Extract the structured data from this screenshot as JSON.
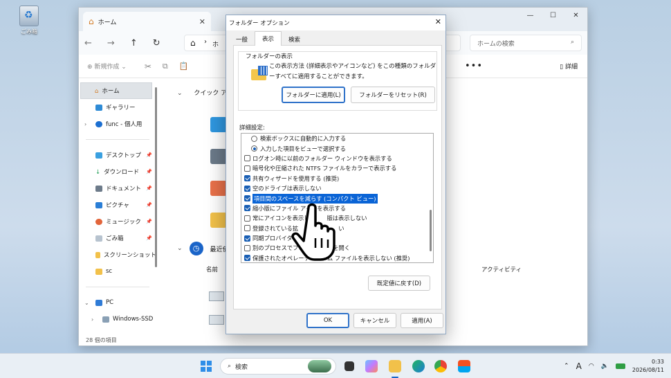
{
  "desktop": {
    "recycle_bin_label": "ごみ箱"
  },
  "explorer": {
    "tab_title": "ホーム",
    "search_placeholder": "ホームの検索",
    "toolbar": {
      "new_label": "新規作成",
      "more_label": "•••",
      "details_label": "詳細"
    },
    "address_crumb": "ホ",
    "sidebar": [
      {
        "label": "ホーム",
        "selected": true
      },
      {
        "label": "ギャラリー"
      },
      {
        "label": "func - 個人用"
      },
      {
        "label": "デスクトップ"
      },
      {
        "label": "ダウンロード"
      },
      {
        "label": "ドキュメント"
      },
      {
        "label": "ピクチャ"
      },
      {
        "label": "ミュージック"
      },
      {
        "label": "ごみ箱"
      },
      {
        "label": "スクリーンショット"
      },
      {
        "label": "sc"
      },
      {
        "label": "PC"
      },
      {
        "label": "Windows-SSD"
      }
    ],
    "quick_access_label": "クイック アク",
    "recent_label": "最近使",
    "column_name": "名前",
    "column_activity": "アクティビティ",
    "status_text": "28 個の項目"
  },
  "dialog": {
    "title": "フォルダー オプション",
    "tabs": [
      "一般",
      "表示",
      "検索"
    ],
    "active_tab": "表示",
    "group_label": "フォルダーの表示",
    "group_desc": "この表示方法 (詳細表示やアイコンなど) をこの種類のフォルダーすべてに適用することができます。",
    "apply_folders_label": "フォルダーに適用(L)",
    "reset_folders_label": "フォルダーをリセット(R)",
    "advanced_label": "詳細設定:",
    "items": [
      {
        "type": "radio",
        "checked": false,
        "text": "検索ボックスに自動的に入力する",
        "indent": 1
      },
      {
        "type": "radio",
        "checked": true,
        "text": "入力した項目をビューで選択する",
        "indent": 1
      },
      {
        "type": "check",
        "checked": false,
        "text": "ログオン時に以前のフォルダー ウィンドウを表示する"
      },
      {
        "type": "check",
        "checked": false,
        "text": "暗号化や圧縮された NTFS ファイルをカラーで表示する"
      },
      {
        "type": "check",
        "checked": true,
        "text": "共有ウィザードを使用する (推奨)"
      },
      {
        "type": "check",
        "checked": true,
        "text": "空のドライブは表示しない"
      },
      {
        "type": "check",
        "checked": true,
        "text": "項目間のスペースを減らす (コンパクト ビュー)",
        "highlight": true
      },
      {
        "type": "check",
        "checked": true,
        "text": "縮小版にファイル アイ　を表示する"
      },
      {
        "type": "check",
        "checked": false,
        "text": "常にアイコンを表示し　　　版は表示しない"
      },
      {
        "type": "check",
        "checked": false,
        "text": "登録されている拡　　　　　　　い"
      },
      {
        "type": "check",
        "checked": true,
        "text": "同期プロバイダー　　　　　る"
      },
      {
        "type": "check",
        "checked": false,
        "text": "別のプロセスでフォル　　　　を開く"
      },
      {
        "type": "check",
        "checked": true,
        "text": "保護されたオペレーテ　　　ム ファイルを表示しない (推奨)"
      }
    ],
    "restore_defaults_label": "既定値に戻す(D)",
    "ok_label": "OK",
    "cancel_label": "キャンセル",
    "apply_label": "適用(A)"
  },
  "taskbar": {
    "search_placeholder": "検索",
    "ime_label": "A",
    "time": "0:33",
    "date": "2026/08/11"
  }
}
